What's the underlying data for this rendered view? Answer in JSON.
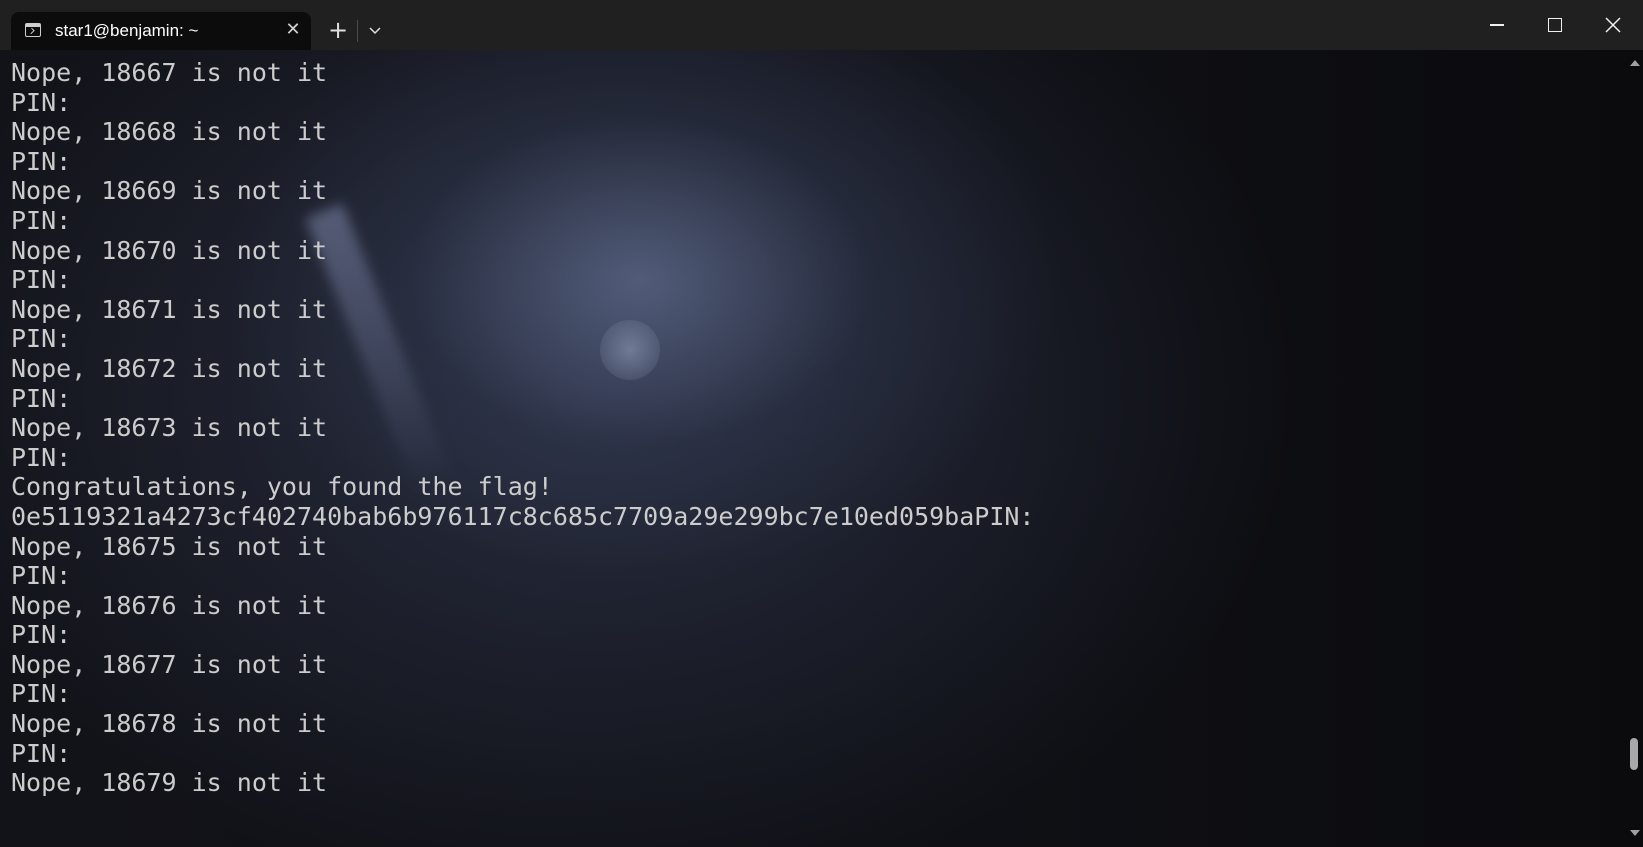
{
  "tab": {
    "title": "star1@benjamin: ~",
    "close_glyph": "✕"
  },
  "titlebar": {
    "new_tab_glyph": "+",
    "dropdown_icon": "chevron-down-icon",
    "minimize_icon": "minimize-icon",
    "maximize_icon": "maximize-icon",
    "close_icon": "close-icon"
  },
  "terminal": {
    "text_color": "#cccccc",
    "lines": [
      "Nope, 18667 is not it",
      "PIN:",
      "Nope, 18668 is not it",
      "PIN:",
      "Nope, 18669 is not it",
      "PIN:",
      "Nope, 18670 is not it",
      "PIN:",
      "Nope, 18671 is not it",
      "PIN:",
      "Nope, 18672 is not it",
      "PIN:",
      "Nope, 18673 is not it",
      "PIN:",
      "Congratulations, you found the flag!",
      "0e5119321a4273cf402740bab6b976117c8c685c7709a29e299bc7e10ed059baPIN:",
      "Nope, 18675 is not it",
      "PIN:",
      "Nope, 18676 is not it",
      "PIN:",
      "Nope, 18677 is not it",
      "PIN:",
      "Nope, 18678 is not it",
      "PIN:",
      "Nope, 18679 is not it"
    ]
  },
  "scrollbar": {
    "position_fraction": 0.98
  }
}
